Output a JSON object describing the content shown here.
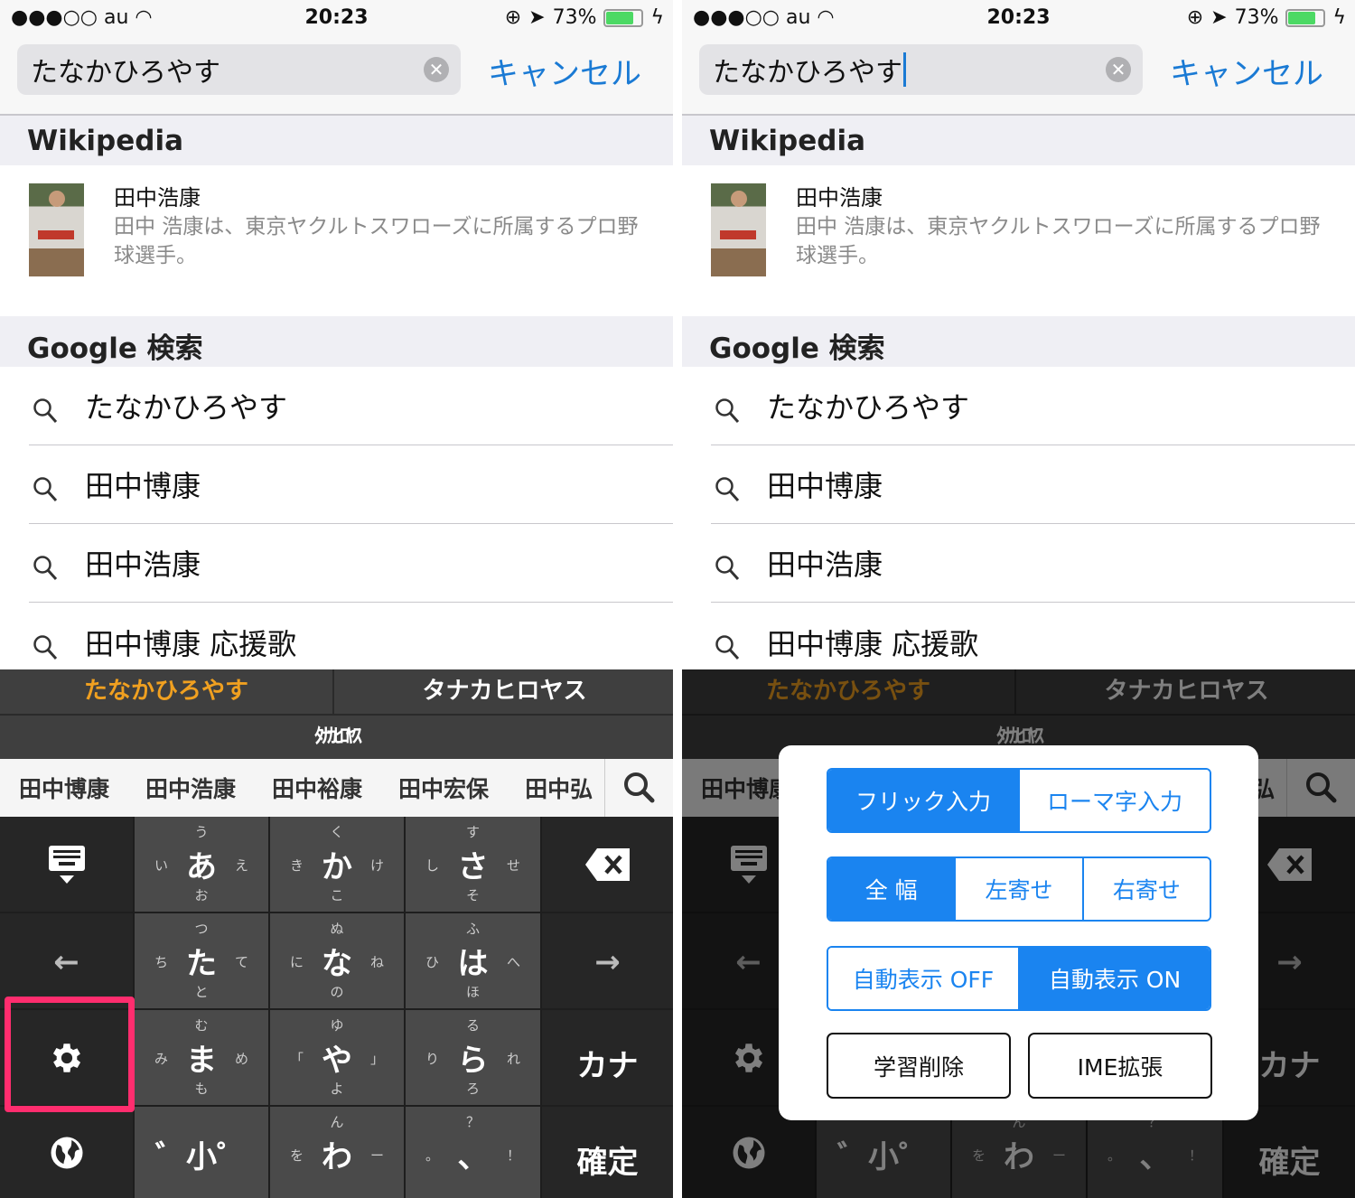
{
  "status": {
    "signal": "●●●○○",
    "carrier": "au",
    "time": "20:23",
    "battery": "73%"
  },
  "search": {
    "query": "たなかひろやす",
    "cancel": "キャンセル"
  },
  "wikipedia": {
    "header": "Wikipedia",
    "title": "田中浩康",
    "description": "田中 浩康は、東京ヤクルトスワローズに所属するプロ野球選手。"
  },
  "google": {
    "header": "Google 検索",
    "suggestions": [
      "たなかひろやす",
      "田中博康",
      "田中浩康",
      "田中博康 応援歌"
    ]
  },
  "keyboard": {
    "candidates": [
      "たなかひろやす",
      "タナカヒロヤス"
    ],
    "halfwidth": "ﾀﾅｶﾋﾛﾔｽ",
    "conversions": [
      "田中博康",
      "田中浩康",
      "田中裕康",
      "田中宏保",
      "田中弘"
    ],
    "keys": [
      {
        "m": "あ",
        "t": "う",
        "l": "い",
        "r": "え",
        "b": "お"
      },
      {
        "m": "か",
        "t": "く",
        "l": "き",
        "r": "け",
        "b": "こ"
      },
      {
        "m": "さ",
        "t": "す",
        "l": "し",
        "r": "せ",
        "b": "そ"
      },
      {
        "m": "た",
        "t": "つ",
        "l": "ち",
        "r": "て",
        "b": "と"
      },
      {
        "m": "な",
        "t": "ぬ",
        "l": "に",
        "r": "ね",
        "b": "の"
      },
      {
        "m": "は",
        "t": "ふ",
        "l": "ひ",
        "r": "へ",
        "b": "ほ"
      },
      {
        "m": "ま",
        "t": "む",
        "l": "み",
        "r": "め",
        "b": "も"
      },
      {
        "m": "や",
        "t": "ゆ",
        "l": "「",
        "r": "」",
        "b": "よ"
      },
      {
        "m": "ら",
        "t": "る",
        "l": "り",
        "r": "れ",
        "b": "ろ"
      },
      {
        "m": "゛小゜",
        "t": "",
        "l": "",
        "r": "",
        "b": ""
      },
      {
        "m": "わ",
        "t": "ん",
        "l": "を",
        "r": "ー",
        "b": ""
      },
      {
        "m": "、",
        "t": "？",
        "l": "。",
        "r": "！",
        "b": ""
      }
    ],
    "kana": "カナ",
    "confirm": "確定",
    "left_arrow": "←",
    "right_arrow": "→"
  },
  "settings_popup": {
    "input_mode": [
      "フリック入力",
      "ローマ字入力"
    ],
    "input_mode_selected": 0,
    "layout": [
      "全 幅",
      "左寄せ",
      "右寄せ"
    ],
    "layout_selected": 0,
    "auto_display": [
      "自動表示 OFF",
      "自動表示 ON"
    ],
    "auto_display_selected": 1,
    "clear_learning": "学習削除",
    "ime_extension": "IME拡張"
  },
  "colors": {
    "accent": "#1a84f0",
    "candidate": "#f0a020",
    "highlight": "#ff2d6e"
  }
}
